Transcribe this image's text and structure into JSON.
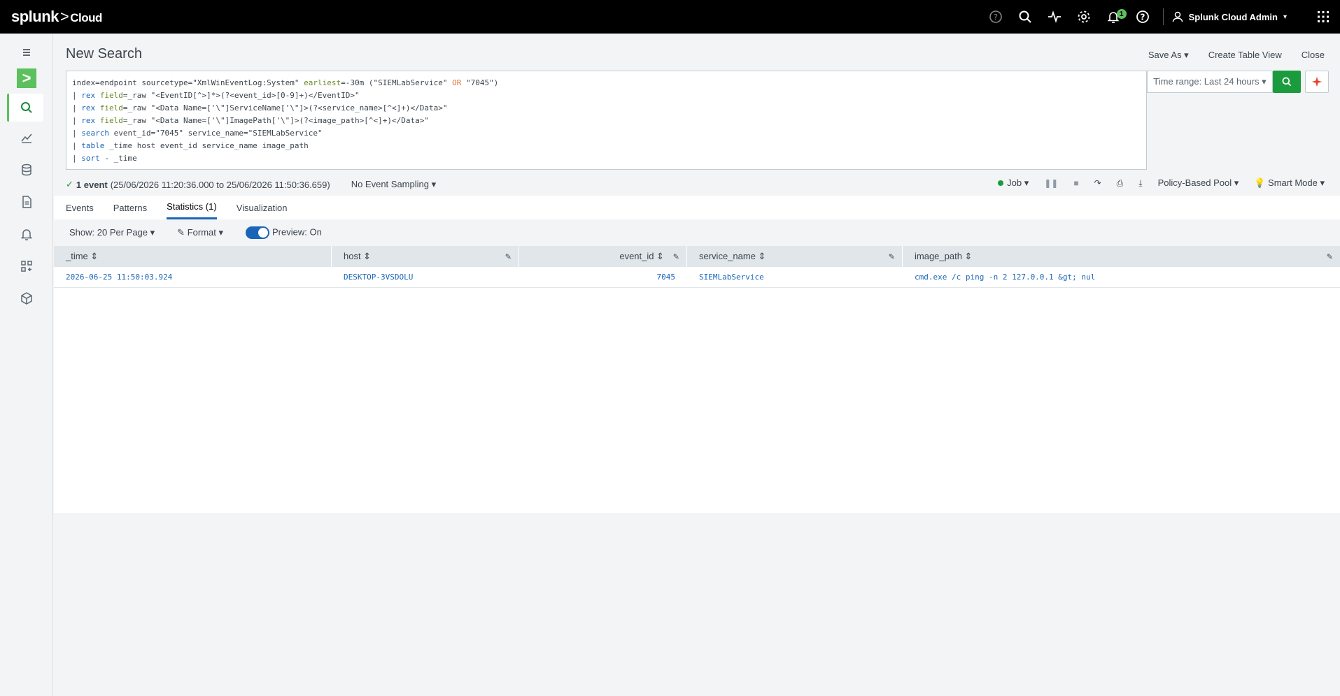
{
  "topbar": {
    "logo_brand": "splunk",
    "logo_gt": ">",
    "logo_product": "Cloud",
    "bell_count": "1",
    "user_name": "Splunk Cloud Admin"
  },
  "page": {
    "title": "New Search",
    "save_as": "Save As ▾",
    "create_table_view": "Create Table View",
    "close": "Close"
  },
  "search": {
    "line1_a": "index=endpoint sourcetype=\"XmlWinEventLog:System\" ",
    "line1_kw": "earliest",
    "line1_b": "=-30m (\"SIEMLabService\" ",
    "line1_op": "OR",
    "line1_c": " \"7045\")",
    "line2_pipe": "| ",
    "line2_cmd": "rex",
    "line2_arg": " field",
    "line2_rest": "=_raw \"<EventID[^>]*>(?<event_id>[0-9]+)</EventID>\"",
    "line3_cmd": "rex",
    "line3_arg": " field",
    "line3_rest": "=_raw \"<Data Name=['\\\"]ServiceName['\\\"]>(?<service_name>[^<]+)</Data>\"",
    "line4_cmd": "rex",
    "line4_arg": " field",
    "line4_rest": "=_raw \"<Data Name=['\\\"]ImagePath['\\\"]>(?<image_path>[^<]+)</Data>\"",
    "line5_cmd": "search",
    "line5_rest": " event_id=\"7045\" service_name=\"SIEMLabService\"",
    "line6_cmd": "table",
    "line6_rest": " _time host event_id service_name image_path",
    "line7_cmd": "sort",
    "line7_rest": " - _time",
    "time_range": "Time range: Last 24 hours ▾"
  },
  "status": {
    "check": "✓",
    "event_count": "1 event",
    "range": "(25/06/2026 11:20:36.000 to 25/06/2026 11:50:36.659)",
    "sampling": "No Event Sampling ▾",
    "job": "Job ▾",
    "pool": "Policy-Based Pool ▾",
    "mode": "Smart Mode ▾"
  },
  "tabs": [
    "Events",
    "Patterns",
    "Statistics (1)",
    "Visualization"
  ],
  "toolbar": {
    "show": "Show: 20 Per Page ▾",
    "format": "Format ▾",
    "preview": "Preview: On"
  },
  "table": {
    "columns": [
      "_time ⇕",
      "host ⇕",
      "event_id ⇕",
      "service_name ⇕",
      "image_path ⇕"
    ],
    "rows": [
      [
        "2026-06-25 11:50:03.924",
        "DESKTOP-3VSDOLU",
        "7045",
        "SIEMLabService",
        "cmd.exe /c ping -n 2 127.0.0.1 &gt; nul"
      ]
    ]
  }
}
